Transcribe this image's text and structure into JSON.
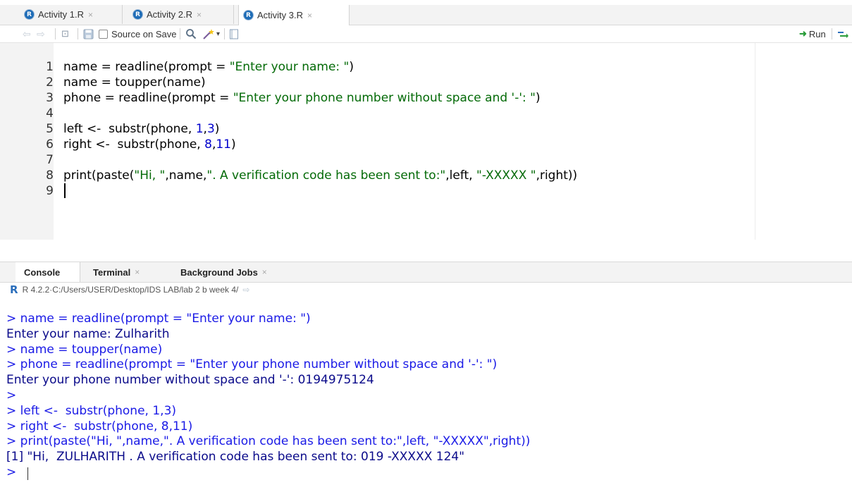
{
  "editor": {
    "tabs": [
      {
        "label": "Activity 1.R",
        "active": false
      },
      {
        "label": "Activity 2.R",
        "active": false
      },
      {
        "label": "Activity 3.R",
        "active": true
      }
    ],
    "tab_close": "×",
    "doc_icon_letter": "R",
    "toolbar": {
      "back_icon": "⇦",
      "forward_icon": "⇨",
      "show_in_window_icon": "⊡",
      "save_icon": "save-icon",
      "source_on_save_label": "Source on Save",
      "source_on_save_checked": false,
      "search_icon": "🔍",
      "wand_icon": "✨",
      "wand_dropdown": "▾",
      "compile_icon": "▤",
      "run_label": "Run",
      "run_arrow": "➜",
      "rerun_icon": "⇄"
    },
    "lines": [
      {
        "n": "1",
        "parts": [
          {
            "t": "name = readline(prompt = ",
            "c": "plain"
          },
          {
            "t": "\"Enter your name: \"",
            "c": "str"
          },
          {
            "t": ")",
            "c": "plain"
          }
        ]
      },
      {
        "n": "2",
        "parts": [
          {
            "t": "name = toupper(name)",
            "c": "plain"
          }
        ]
      },
      {
        "n": "3",
        "parts": [
          {
            "t": "phone = readline(prompt = ",
            "c": "plain"
          },
          {
            "t": "\"Enter your phone number without space and '-': \"",
            "c": "str"
          },
          {
            "t": ")",
            "c": "plain"
          }
        ]
      },
      {
        "n": "4",
        "parts": []
      },
      {
        "n": "5",
        "parts": [
          {
            "t": "left <-  substr(phone, ",
            "c": "plain"
          },
          {
            "t": "1",
            "c": "num"
          },
          {
            "t": ",",
            "c": "plain"
          },
          {
            "t": "3",
            "c": "num"
          },
          {
            "t": ")",
            "c": "plain"
          }
        ]
      },
      {
        "n": "6",
        "parts": [
          {
            "t": "right <-  substr(phone, ",
            "c": "plain"
          },
          {
            "t": "8",
            "c": "num"
          },
          {
            "t": ",",
            "c": "plain"
          },
          {
            "t": "11",
            "c": "num"
          },
          {
            "t": ")",
            "c": "plain"
          }
        ]
      },
      {
        "n": "7",
        "parts": []
      },
      {
        "n": "8",
        "parts": [
          {
            "t": "print(paste(",
            "c": "plain"
          },
          {
            "t": "\"Hi, \"",
            "c": "str"
          },
          {
            "t": ",name,",
            "c": "plain"
          },
          {
            "t": "\". A verification code has been sent to:\"",
            "c": "str"
          },
          {
            "t": ",left, ",
            "c": "plain"
          },
          {
            "t": "\"-XXXXX \"",
            "c": "str"
          },
          {
            "t": ",right))",
            "c": "plain"
          }
        ]
      },
      {
        "n": "9",
        "parts": []
      }
    ]
  },
  "console": {
    "tabs": [
      {
        "label": "Console",
        "closable": false
      },
      {
        "label": "Terminal",
        "closable": true
      },
      {
        "label": "Background Jobs",
        "closable": true
      }
    ],
    "r_logo": "R",
    "r_version": "R 4.2.2",
    "separator": " · ",
    "working_dir": "C:/Users/USER/Desktop/IDS LAB/lab 2 b week 4/",
    "goto_dir_icon": "⇨",
    "lines": [
      {
        "text": "> name = readline(prompt = \"Enter your name: \")",
        "kind": "cmd"
      },
      {
        "text": "Enter your name: Zulharith",
        "kind": "out"
      },
      {
        "text": "> name = toupper(name)",
        "kind": "cmd"
      },
      {
        "text": "> phone = readline(prompt = \"Enter your phone number without space and '-': \")",
        "kind": "cmd"
      },
      {
        "text": "Enter your phone number without space and '-': 0194975124",
        "kind": "out"
      },
      {
        "text": ">",
        "kind": "cmd"
      },
      {
        "text": "> left <-  substr(phone, 1,3)",
        "kind": "cmd"
      },
      {
        "text": "> right <-  substr(phone, 8,11)",
        "kind": "cmd"
      },
      {
        "text": "> print(paste(\"Hi, \",name,\". A verification code has been sent to:\",left, \"-XXXXX\",right))",
        "kind": "cmd"
      },
      {
        "text": "[1] \"Hi,  ZULHARITH . A verification code has been sent to: 019 -XXXXX 124\"",
        "kind": "out"
      },
      {
        "text": "> ",
        "kind": "cmd"
      }
    ]
  }
}
